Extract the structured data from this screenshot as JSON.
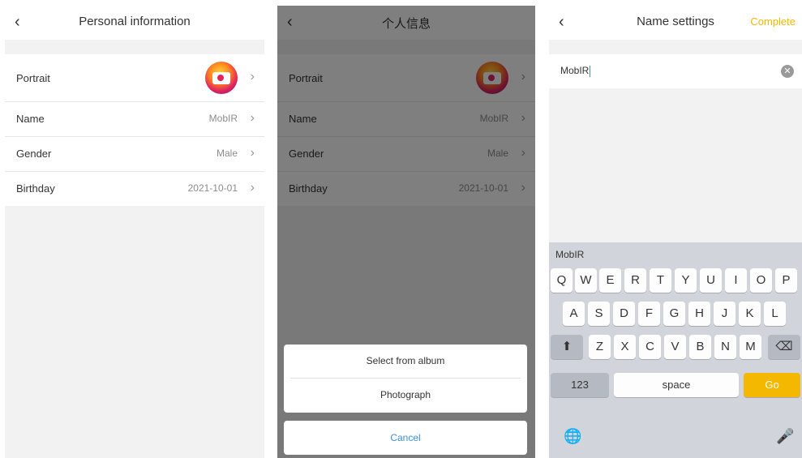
{
  "screen1": {
    "title": "Personal information",
    "back": "‹",
    "rows": [
      {
        "label": "Portrait",
        "value": ""
      },
      {
        "label": "Name",
        "value": "MobIR"
      },
      {
        "label": "Gender",
        "value": "Male"
      },
      {
        "label": "Birthday",
        "value": "2021-10-01"
      }
    ]
  },
  "screen2": {
    "title": "个人信息",
    "back": "‹",
    "rows": [
      {
        "label": "Portrait",
        "value": ""
      },
      {
        "label": "Name",
        "value": "MobIR"
      },
      {
        "label": "Gender",
        "value": "Male"
      },
      {
        "label": "Birthday",
        "value": "2021-10-01"
      }
    ],
    "sheet": {
      "option1": "Select from album",
      "option2": "Photograph",
      "cancel": "Cancel"
    }
  },
  "screen3": {
    "title": "Name settings",
    "back": "‹",
    "action": "Complete",
    "input_value": "MobIR",
    "clear_icon": "✕",
    "keyboard": {
      "suggestion": "MobIR",
      "row1": [
        "Q",
        "W",
        "E",
        "R",
        "T",
        "Y",
        "U",
        "I",
        "O",
        "P"
      ],
      "row2": [
        "A",
        "S",
        "D",
        "F",
        "G",
        "H",
        "J",
        "K",
        "L"
      ],
      "row3": [
        "Z",
        "X",
        "C",
        "V",
        "B",
        "N",
        "M"
      ],
      "shift_icon": "⬆",
      "delete_icon": "⌫",
      "numbers": "123",
      "space": "space",
      "go": "Go",
      "globe_icon": "🌐",
      "mic_icon": "🎤"
    }
  },
  "chevron": "›",
  "colors": {
    "accent": "#f5b800",
    "link": "#3d8fd6",
    "overlay": "rgba(0,0,0,0.5)"
  }
}
